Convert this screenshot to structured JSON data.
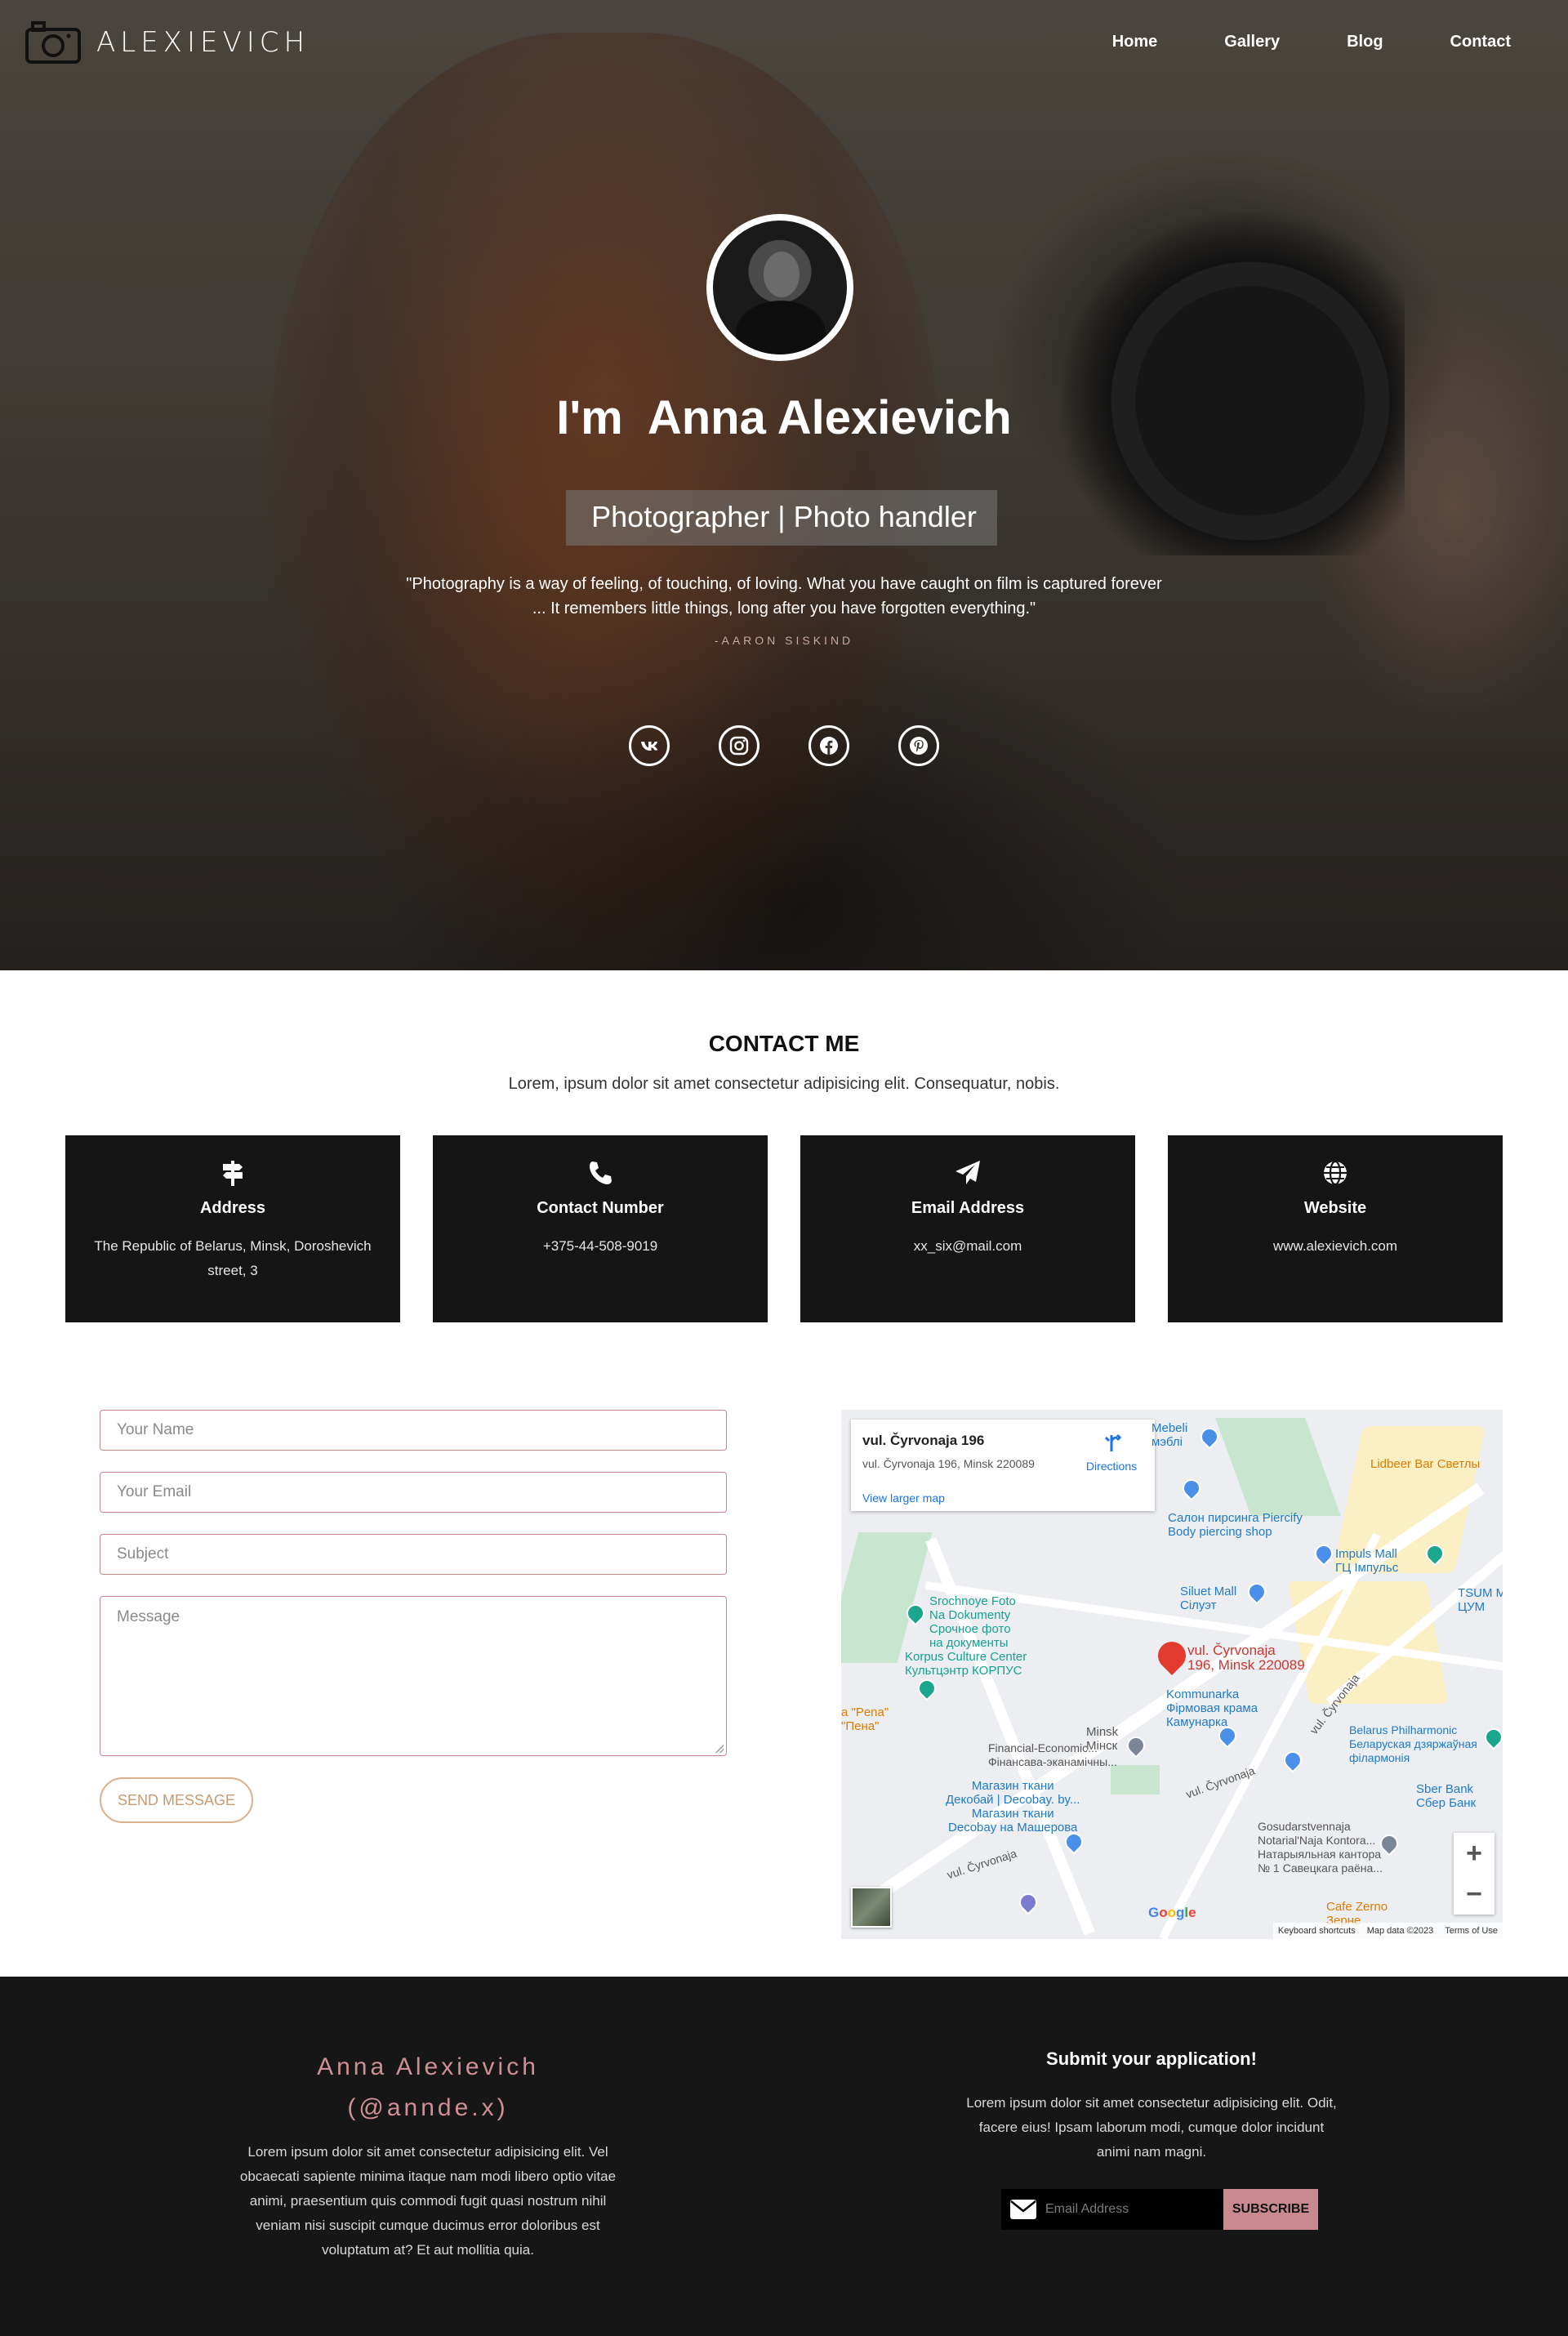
{
  "nav": {
    "logo_text": "ALEXIEVICH",
    "links": [
      "Home",
      "Gallery",
      "Blog",
      "Contact"
    ]
  },
  "hero": {
    "title": "I'm  Anna Alexievich",
    "subtitle": "Photographer | Photo handler",
    "quote": "\"Photography is a way of feeling, of touching, of loving. What you have caught on film is captured forever ... It remembers little things, long after you have forgotten everything.\"",
    "quote_author": "-AARON SISKIND",
    "socials": [
      "vk-icon",
      "instagram-icon",
      "facebook-icon",
      "pinterest-icon"
    ]
  },
  "contact": {
    "title": "CONTACT ME",
    "lead": "Lorem, ipsum dolor sit amet consectetur adipisicing elit. Consequatur, nobis.",
    "cards": [
      {
        "icon": "signpost-icon",
        "title": "Address",
        "text": "The Republic of Belarus, Minsk, Doroshevich street, 3"
      },
      {
        "icon": "phone-icon",
        "title": "Contact Number",
        "text": "+375-44-508-9019"
      },
      {
        "icon": "paper-plane-icon",
        "title": "Email Address",
        "text": "xx_six@mail.com"
      },
      {
        "icon": "globe-icon",
        "title": "Website",
        "text": "www.alexievich.com"
      }
    ],
    "form": {
      "name_placeholder": "Your Name",
      "email_placeholder": "Your Email",
      "subject_placeholder": "Subject",
      "message_placeholder": "Message",
      "send_label": "SEND MESSAGE"
    }
  },
  "map": {
    "card_title": "vul. Čyrvonaja 196",
    "card_address": "vul. Čyrvonaja 196, Minsk 220089",
    "directions": "Directions",
    "larger_map": "View larger map",
    "labels": {
      "mebeli": "Mebeli\nмэблі",
      "lidbeer": "Lidbeer Bar Светлы",
      "piercing": "Салон пирсинга Piercify\nBody piercing shop",
      "impuls": "Impuls Mall\nГЦ Імпульс",
      "siluet": "Siluet Mall\nСілуэт",
      "tsum": "TSUM M\nЦУМ",
      "srochnoye": "Srochnoye Foto\nNa Dokumenty\nСрочное фото\nна документы",
      "korpus": "Korpus Culture Center\nКультцэнтр КОРПУС",
      "pin": "vul. Čyrvonaja\n196, Minsk 220089",
      "kommunarka": "Kommunarka\nФірмовая крама\nКамунарка",
      "pena": "a \"Pena\"\n\"Пена\"",
      "minsk": "Minsk\nМінск",
      "financial": "Financial-Economic...\nФінансава-эканамічны...",
      "dekobai": "Магазин ткани\nДекобай | Decobay. by...\nМагазин ткани\nDecobay на Машерова",
      "philharmonic": "Belarus Philharmonic\nБеларуская дзяржаўная\nфілармонія",
      "sberbank": "Sber Bank\nСбер Банк",
      "gosudarstvennaja": "Gosudarstvennaja\nNotarial'Naja Kontora...\nНатарыяльная кантора\n№ 1 Савецкага раёна...",
      "cafe": "Cafe Zerno\nЗерне",
      "street1": "vul. Čyrvonaja",
      "street2": "vul. Čyrvonaja",
      "street3": "vul. Čyrvonaja"
    },
    "google": "Google",
    "footer_keyboard": "Keyboard shortcuts",
    "footer_data": "Map data ©2023",
    "footer_terms": "Terms of Use",
    "zoom_in": "+",
    "zoom_out": "−"
  },
  "footer": {
    "name": "Anna Alexievich",
    "handle": "(@annde.x)",
    "description": "Lorem ipsum dolor sit amet consectetur adipisicing elit. Vel obcaecati sapiente minima itaque nam modi libero optio vitae animi, praesentium quis commodi fugit quasi nostrum nihil veniam nisi suscipit cumque ducimus error doloribus est voluptatum at? Et aut mollitia quia.",
    "subscribe_title": "Submit your application!",
    "subscribe_text": "Lorem ipsum dolor sit amet consectetur adipisicing elit. Odit, facere eius! Ipsam laborum modi, cumque dolor incidunt animi nam magni.",
    "email_placeholder": "Email Address",
    "subscribe_button": "SUBSCRIBE"
  },
  "colors": {
    "accent": "#cf8f95",
    "card_bg": "#151515",
    "footer_bg": "#161616"
  }
}
